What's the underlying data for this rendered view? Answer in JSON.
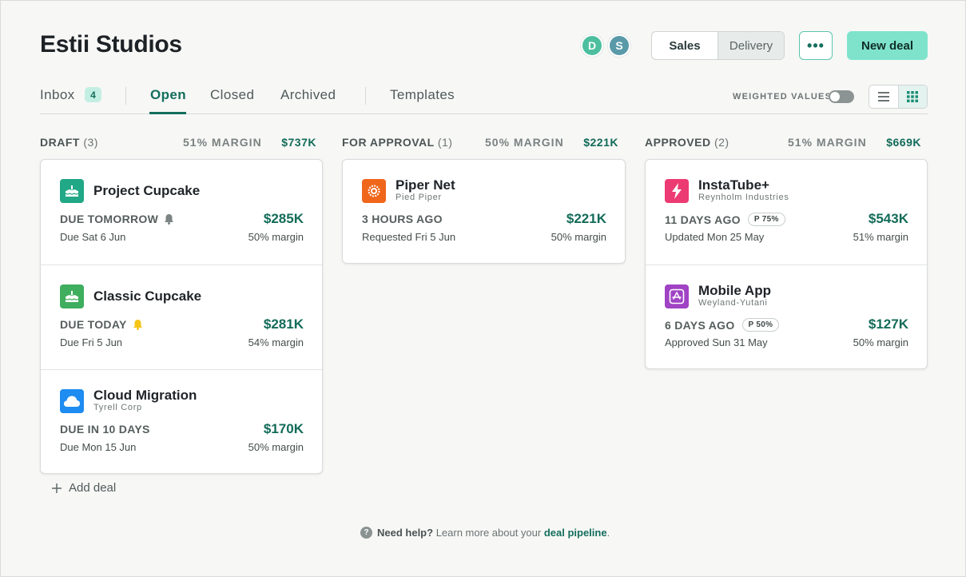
{
  "header": {
    "title": "Estii Studios",
    "avatars": [
      {
        "initial": "D",
        "color": "#4dbf9f"
      },
      {
        "initial": "S",
        "color": "#5a9aa8"
      }
    ],
    "segment": {
      "sales": "Sales",
      "delivery": "Delivery"
    },
    "more_label": "•••",
    "new_deal_label": "New deal"
  },
  "tabs": {
    "inbox": "Inbox",
    "inbox_count": "4",
    "open": "Open",
    "closed": "Closed",
    "archived": "Archived",
    "templates": "Templates",
    "weighted_values": "WEIGHTED VALUES"
  },
  "columns": {
    "draft": {
      "name": "DRAFT",
      "count": "(3)",
      "margin": "51% MARGIN",
      "total": "$737K",
      "deals": [
        {
          "name": "Project Cupcake",
          "sub": "",
          "status": "DUE TOMORROW",
          "date": "Due Sat 6 Jun",
          "value": "$285K",
          "margin": "50% margin",
          "icon": "cake-icon",
          "color": "#21a887"
        },
        {
          "name": "Classic Cupcake",
          "sub": "",
          "status": "DUE TODAY",
          "date": "Due Fri 5 Jun",
          "value": "$281K",
          "margin": "54% margin",
          "icon": "cake-icon",
          "color": "#3fae5e"
        },
        {
          "name": "Cloud Migration",
          "sub": "Tyrell Corp",
          "status": "DUE IN 10 DAYS",
          "date": "Due Mon 15 Jun",
          "value": "$170K",
          "margin": "50% margin",
          "icon": "cloud-icon",
          "color": "#1e8cf0"
        }
      ]
    },
    "approval": {
      "name": "FOR APPROVAL",
      "count": "(1)",
      "margin": "50% MARGIN",
      "total": "$221K",
      "deals": [
        {
          "name": "Piper Net",
          "sub": "Pied Piper",
          "status": "3 HOURS AGO",
          "date": "Requested Fri 5 Jun",
          "value": "$221K",
          "margin": "50% margin",
          "icon": "gear-icon",
          "color": "#f0661b"
        }
      ]
    },
    "approved": {
      "name": "APPROVED",
      "count": "(2)",
      "margin": "51% MARGIN",
      "total": "$669K",
      "deals": [
        {
          "name": "InstaTube+",
          "sub": "Reynholm Industries",
          "status": "11 DAYS AGO",
          "prob": "P 75%",
          "date": "Updated Mon 25 May",
          "value": "$543K",
          "margin": "51% margin",
          "icon": "bolt-icon",
          "color": "#ec3a72"
        },
        {
          "name": "Mobile App",
          "sub": "Weyland-Yutani",
          "status": "6 DAYS AGO",
          "prob": "P 50%",
          "date": "Approved Sun 31 May",
          "value": "$127K",
          "margin": "50% margin",
          "icon": "app-store-icon",
          "color": "#a043c4"
        }
      ]
    }
  },
  "footer": {
    "add_deal": "Add deal",
    "help_q": "?",
    "help_strong": "Need help?",
    "help_text": " Learn more about your ",
    "help_link": "deal pipeline",
    "help_end": "."
  }
}
